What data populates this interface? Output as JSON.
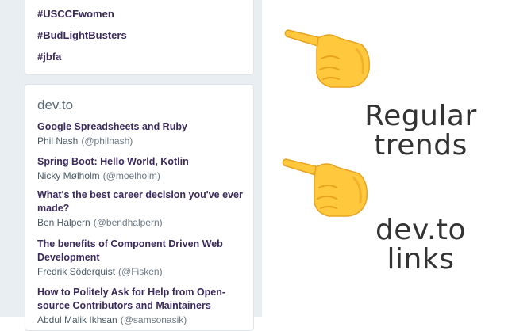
{
  "trends": {
    "items": [
      "#USCCFwomen",
      "#BudLightBusters",
      "#jbfa"
    ]
  },
  "devto": {
    "title": "dev.to",
    "articles": [
      {
        "title": "Google Spreadsheets and Ruby",
        "author": "Phil Nash",
        "handle": "(@philnash)"
      },
      {
        "title": "Spring Boot: Hello World, Kotlin",
        "author": "Nicky Mølholm",
        "handle": "(@moelholm)"
      },
      {
        "title": "What's the best career decision you've ever made?",
        "author": "Ben Halpern",
        "handle": "(@bendhalpern)"
      },
      {
        "title": "The benefits of Component Driven Web Development",
        "author": "Fredrik Söderquist",
        "handle": "(@Fisken)"
      },
      {
        "title": "How to Politely Ask for Help from Open-source Contributors and Maintainers",
        "author": "Abdul Malik Ikhsan",
        "handle": "(@samsonasik)"
      }
    ]
  },
  "annotations": {
    "regular_trends": "Regular trends",
    "devto_links": "dev.to links"
  },
  "icons": {
    "hand": "backhand-index-pointing-left-icon"
  },
  "colors": {
    "link": "#3b2a5c",
    "hand_fill": "#ffc83d",
    "hand_shade": "#e8a320"
  }
}
